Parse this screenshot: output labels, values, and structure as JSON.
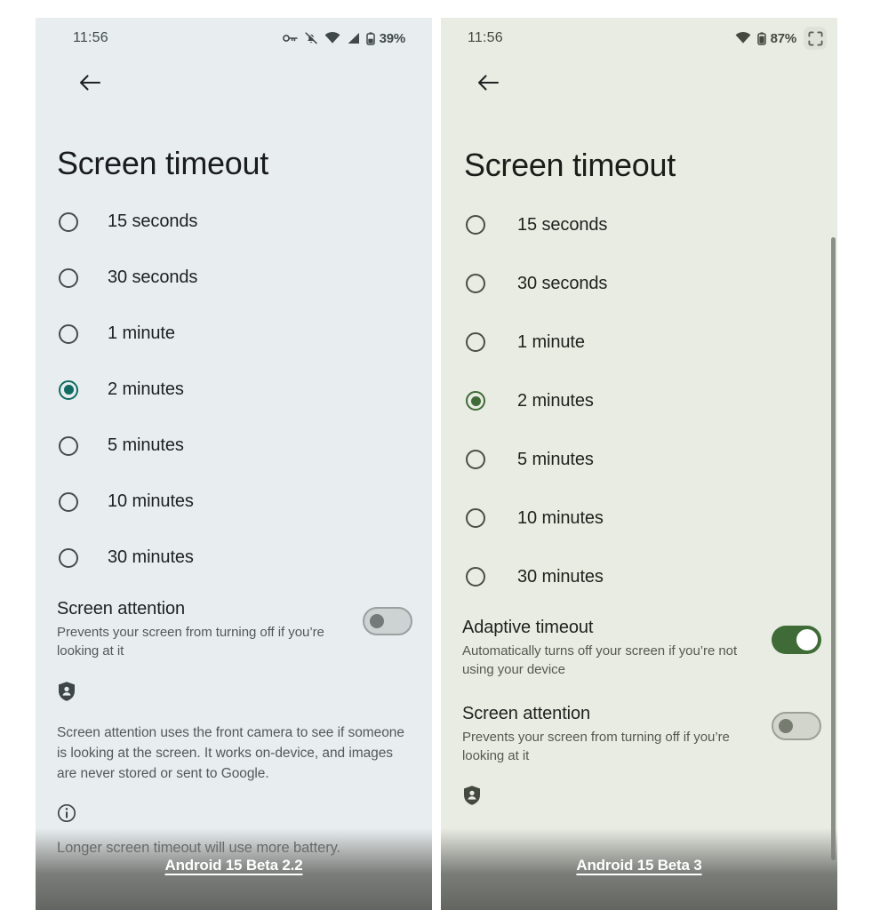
{
  "panels": {
    "left": {
      "name": "Android 15 Beta 2.2 screen timeout settings",
      "background_color": "#e8eef0",
      "accent_color": "#116a63",
      "status_bar": {
        "time": "11:56",
        "battery_percent": "39%",
        "icons": [
          "key-icon",
          "notifications-muted-icon",
          "wifi-icon",
          "signal-icon",
          "battery-icon"
        ]
      },
      "nav": {
        "back_icon": "back-arrow-icon"
      },
      "title": "Screen timeout",
      "options": [
        {
          "label": "15 seconds",
          "selected": false
        },
        {
          "label": "30 seconds",
          "selected": false
        },
        {
          "label": "1 minute",
          "selected": false
        },
        {
          "label": "2 minutes",
          "selected": true
        },
        {
          "label": "5 minutes",
          "selected": false
        },
        {
          "label": "10 minutes",
          "selected": false
        },
        {
          "label": "30 minutes",
          "selected": false
        }
      ],
      "screen_attention": {
        "title": "Screen attention",
        "subtitle": "Prevents your screen from turning off if you’re looking at it",
        "toggle_state": "off"
      },
      "privacy_note": {
        "icon": "privacy-shield-icon",
        "text": "Screen attention uses the front camera to see if someone is looking at the screen. It works on-device, and images are never stored or sent to Google."
      },
      "info_note": {
        "icon": "info-icon",
        "text": "Longer screen timeout will use more battery."
      },
      "caption": "Android 15 Beta 2.2"
    },
    "right": {
      "name": "Android 15 Beta 3 screen timeout settings",
      "background_color": "#e9ece3",
      "accent_color": "#3f6b38",
      "status_bar": {
        "time": "11:56",
        "battery_percent": "87%",
        "icons": [
          "wifi-icon",
          "battery-icon",
          "screenshot-icon"
        ]
      },
      "nav": {
        "back_icon": "back-arrow-icon"
      },
      "title": "Screen timeout",
      "options": [
        {
          "label": "15 seconds",
          "selected": false
        },
        {
          "label": "30 seconds",
          "selected": false
        },
        {
          "label": "1 minute",
          "selected": false
        },
        {
          "label": "2 minutes",
          "selected": true
        },
        {
          "label": "5 minutes",
          "selected": false
        },
        {
          "label": "10 minutes",
          "selected": false
        },
        {
          "label": "30 minutes",
          "selected": false
        }
      ],
      "adaptive_timeout": {
        "title": "Adaptive timeout",
        "subtitle": "Automatically turns off your screen if you’re not using your device",
        "toggle_state": "on"
      },
      "screen_attention": {
        "title": "Screen attention",
        "subtitle": "Prevents your screen from turning off if you’re looking at it",
        "toggle_state": "off"
      },
      "privacy_note": {
        "icon": "privacy-shield-icon"
      },
      "caption": "Android 15 Beta 3"
    }
  }
}
